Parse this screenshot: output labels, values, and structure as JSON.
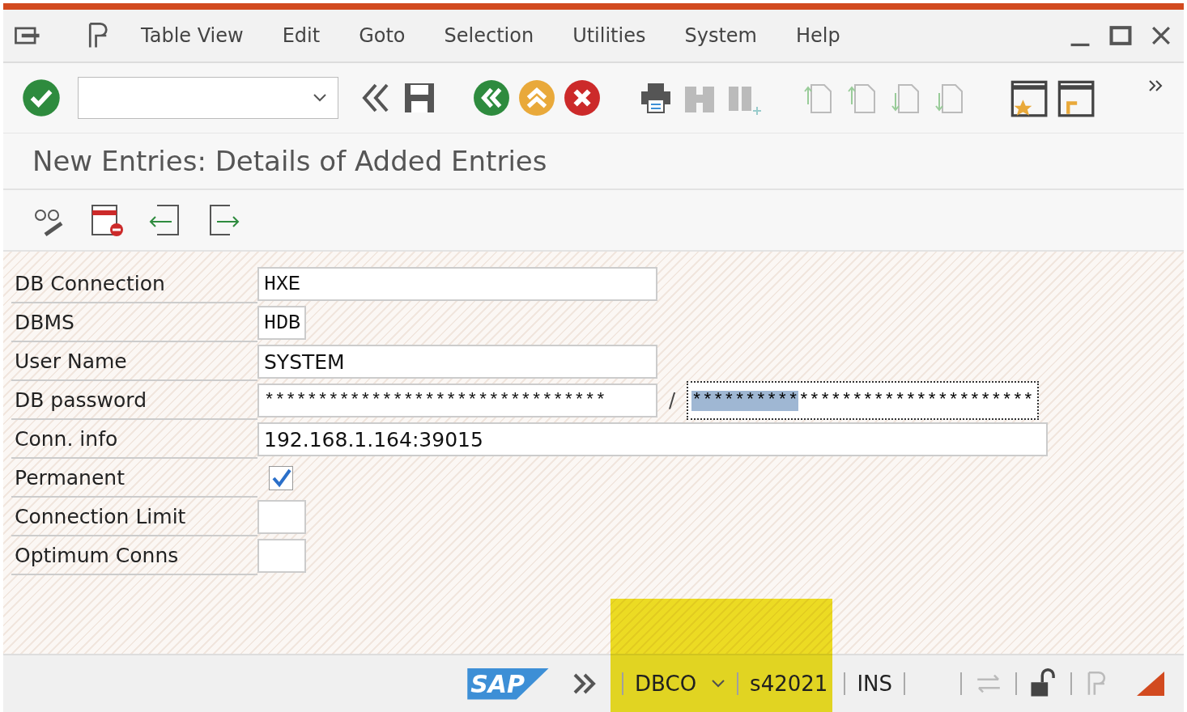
{
  "menu_bar": {
    "items": [
      "Table View",
      "Edit",
      "Goto",
      "Selection",
      "Utilities",
      "System",
      "Help"
    ]
  },
  "title": "New Entries: Details of Added Entries",
  "form": {
    "rows": [
      {
        "kind": "text",
        "label": "DB Connection",
        "value": "HXE"
      },
      {
        "kind": "text",
        "label": "DBMS",
        "value": "HDB"
      },
      {
        "kind": "text",
        "label": "User Name",
        "value": "SYSTEM"
      },
      {
        "kind": "password",
        "label": "DB password",
        "value": "********************************",
        "separator": "/",
        "confirm_selected": "**********",
        "confirm_rest": "**********************"
      },
      {
        "kind": "text",
        "label": "Conn. info",
        "value": "192.168.1.164:39015"
      },
      {
        "kind": "checkbox",
        "label": "Permanent",
        "checked": true
      },
      {
        "kind": "text",
        "label": "Connection Limit"
      },
      {
        "kind": "text",
        "label": "Optimum Conns"
      }
    ]
  },
  "status_bar": {
    "logo": "SAP",
    "transaction": "DBCO",
    "system": "s42021",
    "mode": "INS",
    "highlighted": true
  }
}
